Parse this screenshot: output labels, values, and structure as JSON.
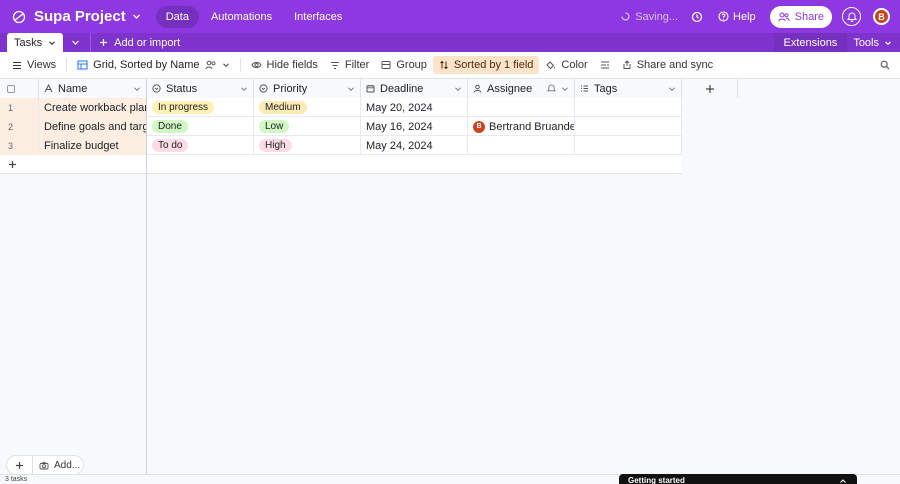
{
  "app": {
    "name": "Supa Project",
    "avatar_initial": "B"
  },
  "topnav": {
    "items": [
      "Data",
      "Automations",
      "Interfaces"
    ]
  },
  "topright": {
    "saving": "Saving...",
    "help": "Help",
    "share": "Share"
  },
  "tabbar": {
    "tab": "Tasks",
    "add_import": "Add or import",
    "extensions": "Extensions",
    "tools": "Tools"
  },
  "viewbar": {
    "views": "Views",
    "view_name": "Grid, Sorted by Name",
    "hide_fields": "Hide fields",
    "filter": "Filter",
    "group": "Group",
    "sorted": "Sorted by 1 field",
    "color": "Color",
    "share_sync": "Share and sync"
  },
  "columns": [
    "Name",
    "Status",
    "Priority",
    "Deadline",
    "Assignee",
    "Tags"
  ],
  "rows": [
    {
      "num": "1",
      "name": "Create workback plan",
      "status": "In progress",
      "priority": "Medium",
      "deadline": "May 20, 2024",
      "assignee": "",
      "tags": ""
    },
    {
      "num": "2",
      "name": "Define goals and targets",
      "status": "Done",
      "priority": "Low",
      "deadline": "May 16, 2024",
      "assignee": "Bertrand Bruandet",
      "tags": ""
    },
    {
      "num": "3",
      "name": "Finalize budget",
      "status": "To do",
      "priority": "High",
      "deadline": "May 24, 2024",
      "assignee": "",
      "tags": ""
    }
  ],
  "colors": {
    "brand": "#8d38e0",
    "status": {
      "In progress": "#fff0b3",
      "Done": "#d1f7c4",
      "To do": "#ffdce5"
    },
    "priority": {
      "Medium": "#ffeab6",
      "Low": "#d1f7c4",
      "High": "#ffdce5"
    }
  },
  "footer": {
    "count": "3 tasks",
    "add": "Add...",
    "getting_started": "Getting started"
  }
}
